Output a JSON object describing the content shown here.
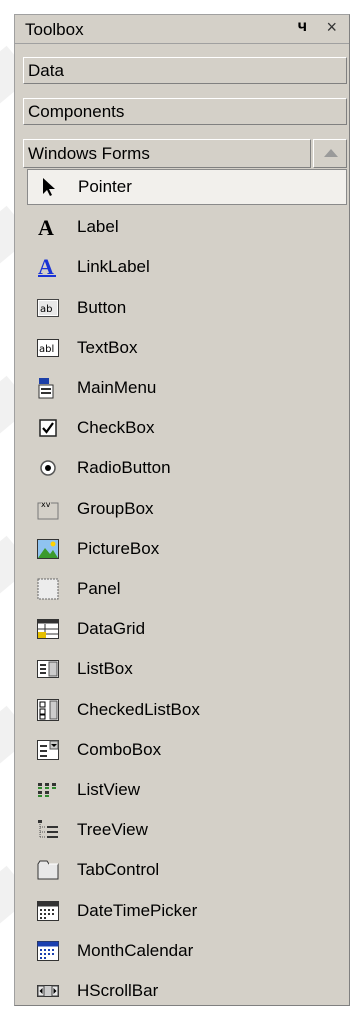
{
  "toolbox": {
    "title": "Toolbox",
    "pin_glyph": "ч",
    "close_glyph": "×"
  },
  "sections": {
    "data": "Data",
    "components": "Components",
    "windows_forms": "Windows Forms"
  },
  "items": [
    {
      "label": "Pointer",
      "icon": "pointer-icon",
      "selected": true
    },
    {
      "label": "Label",
      "icon": "label-icon"
    },
    {
      "label": "LinkLabel",
      "icon": "linklabel-icon"
    },
    {
      "label": "Button",
      "icon": "button-icon"
    },
    {
      "label": "TextBox",
      "icon": "textbox-icon"
    },
    {
      "label": "MainMenu",
      "icon": "mainmenu-icon"
    },
    {
      "label": "CheckBox",
      "icon": "checkbox-icon"
    },
    {
      "label": "RadioButton",
      "icon": "radiobutton-icon"
    },
    {
      "label": "GroupBox",
      "icon": "groupbox-icon"
    },
    {
      "label": "PictureBox",
      "icon": "picturebox-icon"
    },
    {
      "label": "Panel",
      "icon": "panel-icon"
    },
    {
      "label": "DataGrid",
      "icon": "datagrid-icon"
    },
    {
      "label": "ListBox",
      "icon": "listbox-icon"
    },
    {
      "label": "CheckedListBox",
      "icon": "checkedlistbox-icon"
    },
    {
      "label": "ComboBox",
      "icon": "combobox-icon"
    },
    {
      "label": "ListView",
      "icon": "listview-icon"
    },
    {
      "label": "TreeView",
      "icon": "treeview-icon"
    },
    {
      "label": "TabControl",
      "icon": "tabcontrol-icon"
    },
    {
      "label": "DateTimePicker",
      "icon": "datetimepicker-icon"
    },
    {
      "label": "MonthCalendar",
      "icon": "monthcalendar-icon"
    },
    {
      "label": "HScrollBar",
      "icon": "hscrollbar-icon"
    }
  ]
}
